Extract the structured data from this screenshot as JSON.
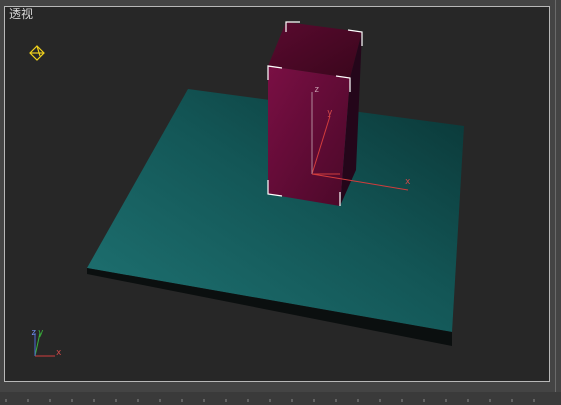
{
  "viewport": {
    "label": "透视"
  },
  "scene": {
    "colors": {
      "plane": "#1d6a6a",
      "box_front": "#6b0d3a",
      "box_top": "#4a0a26",
      "box_side": "#1f0612",
      "selection": "#ffffff",
      "gizmo": "#d23c3c"
    }
  },
  "axes": {
    "x": "x",
    "y": "y",
    "z": "z"
  }
}
